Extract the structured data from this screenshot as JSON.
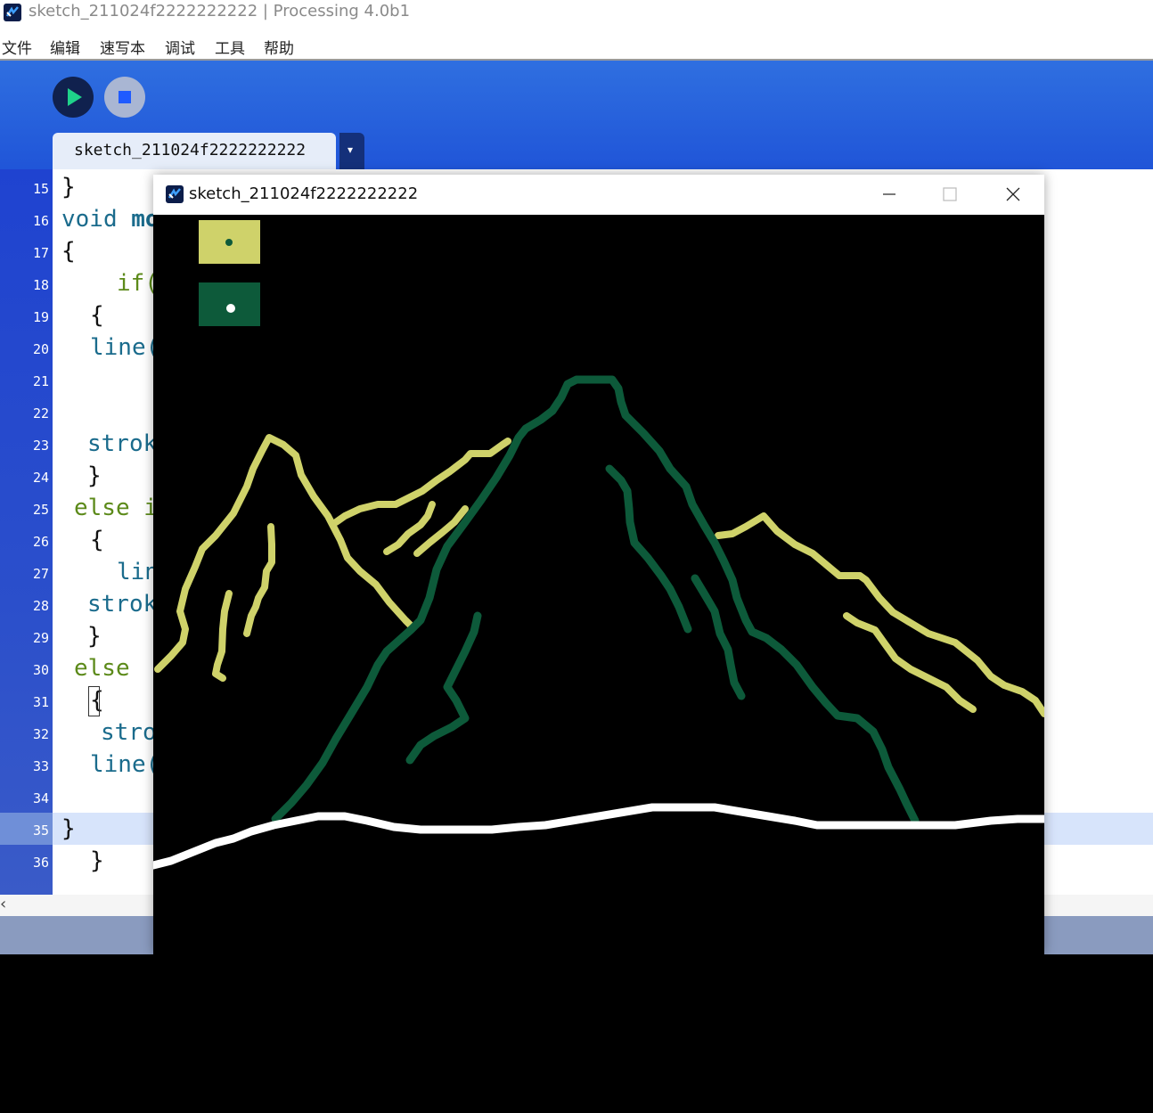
{
  "ide": {
    "title": "sketch_211024f2222222222 | Processing 4.0b1",
    "menu": [
      "文件",
      "编辑",
      "速写本",
      "调试",
      "工具",
      "帮助"
    ],
    "tab_label": "sketch_211024f2222222222",
    "tab_menu_icon": "▾"
  },
  "editor": {
    "lines": [
      {
        "num": "15",
        "text": "}",
        "cls": "k-black",
        "indent": 10
      },
      {
        "num": "16",
        "text": "void",
        "cls": "k-blue",
        "indent": 10,
        "extra": " mo",
        "extra_cls": "k-blue"
      },
      {
        "num": "17",
        "text": "{",
        "cls": "k-black",
        "indent": 10
      },
      {
        "num": "18",
        "text": "if(",
        "cls": "k-green",
        "indent": 72
      },
      {
        "num": "19",
        "text": "{",
        "cls": "k-black",
        "indent": 42
      },
      {
        "num": "20",
        "text": "line(",
        "cls": "k-blue",
        "indent": 42
      },
      {
        "num": "21",
        "text": "",
        "cls": "k-black",
        "indent": 42
      },
      {
        "num": "22",
        "text": "",
        "cls": "k-black",
        "indent": 42
      },
      {
        "num": "23",
        "text": "strok",
        "cls": "k-blue",
        "indent": 39
      },
      {
        "num": "24",
        "text": "}",
        "cls": "k-black",
        "indent": 39
      },
      {
        "num": "25",
        "text": "else i",
        "cls": "k-green",
        "indent": 24
      },
      {
        "num": "26",
        "text": "{",
        "cls": "k-black",
        "indent": 42
      },
      {
        "num": "27",
        "text": "lin",
        "cls": "k-blue",
        "indent": 72
      },
      {
        "num": "28",
        "text": "strok",
        "cls": "k-blue",
        "indent": 39
      },
      {
        "num": "29",
        "text": "}",
        "cls": "k-black",
        "indent": 39
      },
      {
        "num": "30",
        "text": "else",
        "cls": "k-green",
        "indent": 24
      },
      {
        "num": "31",
        "text": "{",
        "cls": "k-black",
        "indent": 42
      },
      {
        "num": "32",
        "text": "stro",
        "cls": "k-blue",
        "indent": 54
      },
      {
        "num": "33",
        "text": "line(",
        "cls": "k-blue",
        "indent": 42
      },
      {
        "num": "34",
        "text": "",
        "cls": "k-black",
        "indent": 42
      },
      {
        "num": "35",
        "text": "}",
        "cls": "k-black",
        "indent": 10
      },
      {
        "num": "36",
        "text": "}",
        "cls": "k-black",
        "indent": 42
      }
    ]
  },
  "sketch": {
    "title": "sketch_211024f2222222222",
    "buttons": {
      "minimize": "—",
      "maximize": "☐",
      "close": "✕"
    }
  },
  "colors": {
    "yellow_green": "#cfd26a",
    "dark_green": "#0d5a3a",
    "white": "#ffffff"
  },
  "icons": {
    "run": "play-icon",
    "stop": "stop-icon",
    "scroll_left": "‹"
  }
}
